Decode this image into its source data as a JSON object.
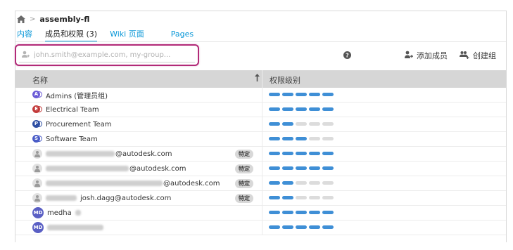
{
  "breadcrumb": {
    "project": "assembly-fl"
  },
  "tabs": [
    {
      "label": "内容",
      "active": false
    },
    {
      "label": "成员和权限 (3)",
      "active": true
    },
    {
      "label": "Wiki 页面",
      "active": false
    },
    {
      "label": "Pages",
      "active": false
    }
  ],
  "search": {
    "placeholder": "john.smith@example.com, my-group..."
  },
  "actions": {
    "add_member": "添加成员",
    "create_group": "创建组"
  },
  "table": {
    "col_name": "名称",
    "col_perm": "权限级别",
    "rows": [
      {
        "kind": "group",
        "letter": "A",
        "color": "#6b5bd6",
        "name": "Admins (管理员组)",
        "level": 5,
        "badge": ""
      },
      {
        "kind": "group",
        "letter": "E",
        "color": "#c33a3a",
        "name": "Electrical Team",
        "level": 5,
        "badge": ""
      },
      {
        "kind": "group",
        "letter": "P",
        "color": "#2e4fa3",
        "name": "Procurement Team",
        "level": 2,
        "badge": ""
      },
      {
        "kind": "group",
        "letter": "S",
        "color": "#4a5cc7",
        "name": "Software Team",
        "level": 3,
        "badge": ""
      },
      {
        "kind": "user",
        "email_suffix": "@autodesk.com",
        "level": 5,
        "badge": "特定"
      },
      {
        "kind": "user",
        "email_suffix": "@autodesk.com",
        "level": 5,
        "badge": "特定"
      },
      {
        "kind": "user",
        "email_suffix": "@autodesk.com",
        "level": 2,
        "badge": "特定"
      },
      {
        "kind": "user",
        "email_suffix": "josh.dagg@autodesk.com",
        "level": 2,
        "badge": "特定"
      },
      {
        "kind": "avatar",
        "initials": "MD",
        "name": "medha",
        "level": 5,
        "badge": ""
      },
      {
        "kind": "avatar",
        "initials": "MD",
        "name": "",
        "level": 5,
        "badge": ""
      }
    ]
  },
  "colors": {
    "accent": "#0696d7",
    "highlight": "#b22a78",
    "level_on": "#3f8fd6",
    "level_off": "#dcdcdc"
  }
}
